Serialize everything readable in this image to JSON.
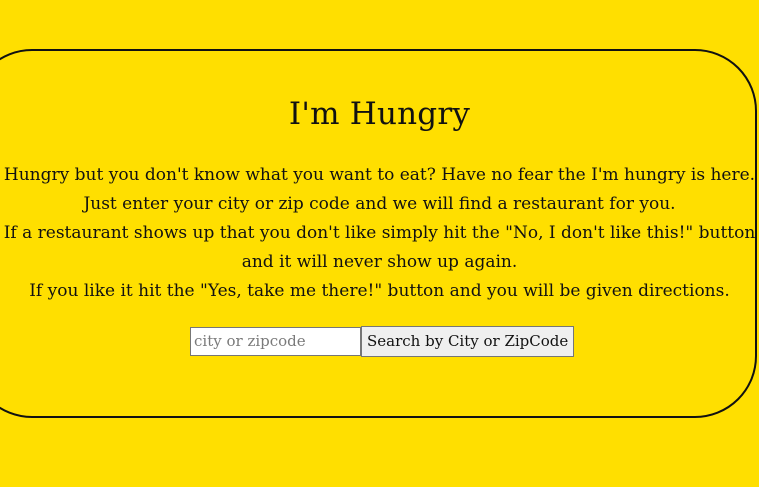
{
  "page": {
    "title": "I'm Hungry",
    "description_lines": [
      "Hungry but you don't know what you want to eat? Have no fear the I'm hungry is here.",
      "Just enter your city or zip code and we will find a restaurant for you.",
      "If a restaurant shows up that you don't like simply hit the \"No, I don't like this!\" button",
      "and it will never show up again.",
      "If you like it hit the \"Yes, take me there!\" button and you will be given directions."
    ]
  },
  "search": {
    "value": "",
    "placeholder": "city or zipcode",
    "button_label": "Search by City or ZipCode"
  },
  "colors": {
    "background": "#ffdf00",
    "border": "#111111"
  }
}
